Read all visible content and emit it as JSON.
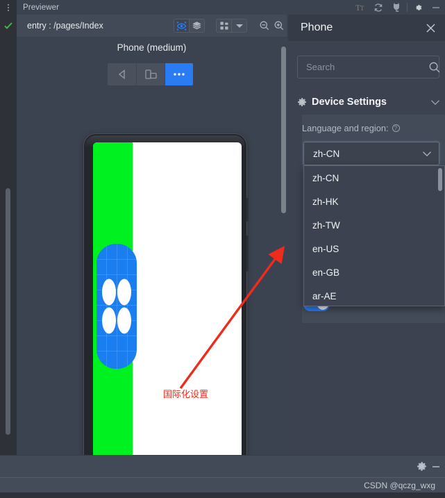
{
  "window": {
    "title": "Previewer",
    "icons": [
      "kebab-menu-icon",
      "text-size-icon",
      "refresh-icon",
      "device-plug-icon",
      "gear-icon",
      "minimize-icon"
    ]
  },
  "preview_toolbar": {
    "entry_label": "entry : /pages/Index",
    "inspect_icon": "inspect-eye-icon",
    "layers_icon": "layers-icon",
    "layout_icon": "layout-grid-icon",
    "dropdown_icon": "chevron-down-icon",
    "zoom_out_icon": "zoom-out-icon",
    "zoom_in_icon": "zoom-in-icon"
  },
  "device": {
    "label": "Phone (medium)",
    "buttons": [
      {
        "name": "back",
        "icon": "back-triangle-icon"
      },
      {
        "name": "rotate",
        "icon": "rotate-device-icon"
      },
      {
        "name": "more",
        "icon": "more-dots-icon"
      }
    ]
  },
  "annotation": {
    "text": "国际化设置",
    "color": "#ee2b1c"
  },
  "phone_screen": {
    "left_panel_color": "#00f120",
    "background_color": "#ffffff",
    "card_color": "#1a7ef0",
    "dot_count": 4
  },
  "panel": {
    "title": "Phone",
    "close_icon": "close-icon",
    "search": {
      "placeholder": "Search",
      "value": "",
      "icon": "search-icon"
    },
    "section": {
      "label": "Device Settings",
      "gear_icon": "gear-icon",
      "chevron_icon": "chevron-down-icon"
    },
    "field": {
      "label": "Language and region:",
      "help_icon": "help-circle-icon",
      "selected": "zh-CN",
      "chevron_icon": "chevron-down-icon",
      "options": [
        "zh-CN",
        "zh-HK",
        "zh-TW",
        "en-US",
        "en-GB",
        "ar-AE"
      ]
    },
    "toggle": {
      "name": "setting-toggle",
      "state": "on",
      "color": "#2a7bf6"
    }
  },
  "bottom": {
    "gear_icon": "gear-icon",
    "minimize_icon": "minimize-icon",
    "watermark": "CSDN @qczg_wxg"
  },
  "colors": {
    "accent": "#2a7bf6",
    "panel_bg": "#3c4250",
    "toolbar_bg": "#434a57",
    "text": "#f1f3f5"
  }
}
